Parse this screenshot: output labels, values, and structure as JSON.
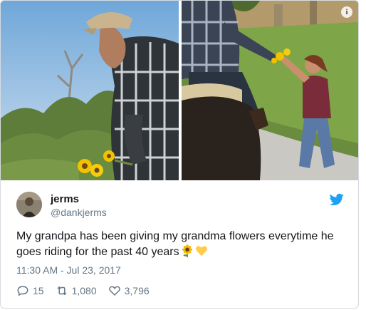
{
  "tweet": {
    "display_name": "jerms",
    "handle": "@dankjerms",
    "text": "My grandpa has been giving my grandma flowers everytime he goes riding for the past 40 years",
    "timestamp": "11:30 AM - Jul 23, 2017",
    "emojis": [
      "sunflower-emoji",
      "yellow-heart-emoji"
    ]
  },
  "actions": {
    "replies": "15",
    "retweets": "1,080",
    "likes": "3,796"
  },
  "colors": {
    "twitter_blue": "#1da1f2",
    "secondary_text": "#657786",
    "primary_text": "#14171a",
    "border": "#d6dbe0"
  },
  "icons": {
    "info": "i",
    "brand": "twitter-bird-icon",
    "reply": "reply-icon",
    "retweet": "retweet-icon",
    "like": "heart-icon"
  }
}
